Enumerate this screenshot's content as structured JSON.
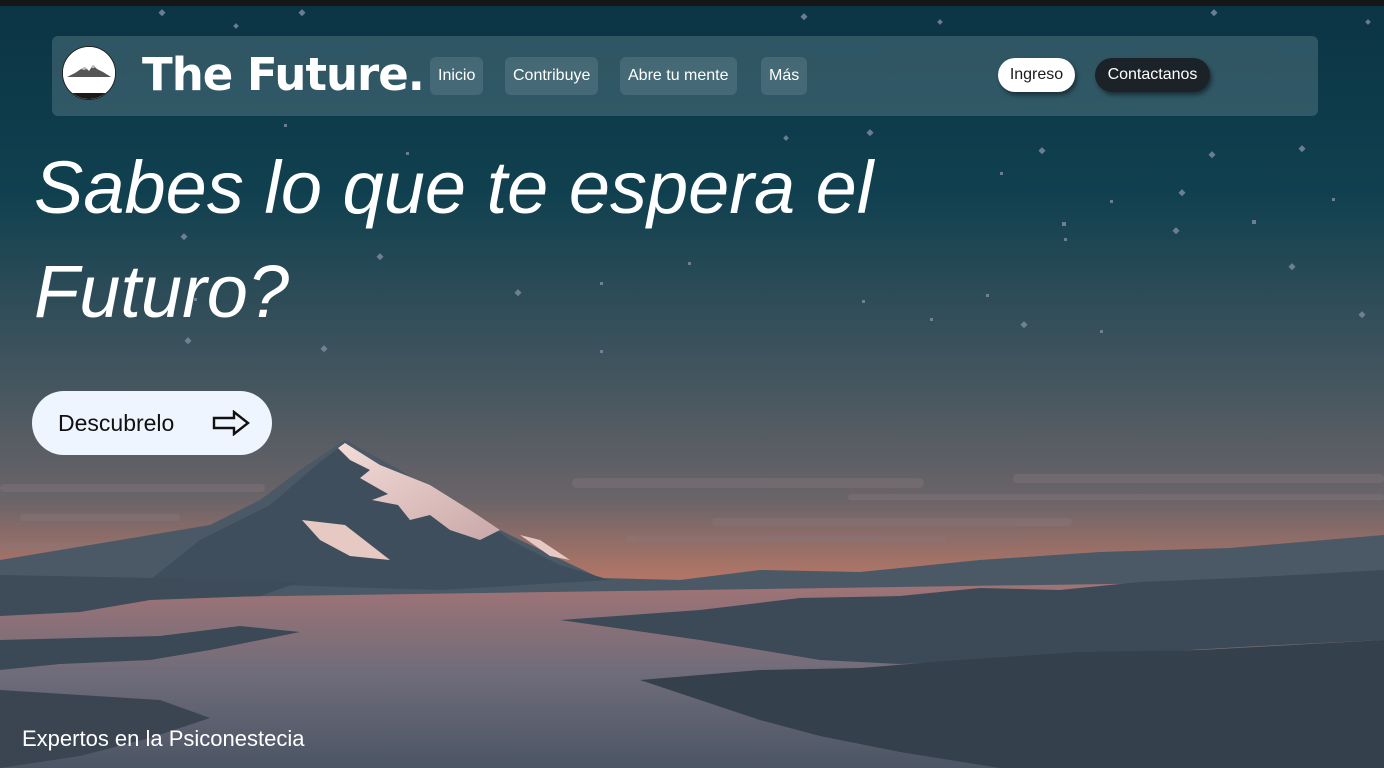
{
  "brand": {
    "name": "The Future.",
    "logo_icon": "mountain-logo-icon"
  },
  "nav": {
    "items": [
      {
        "label": "Inicio"
      },
      {
        "label": "Contribuye"
      },
      {
        "label": "Abre tu mente"
      },
      {
        "label": "Más"
      }
    ],
    "login_label": "Ingreso",
    "contact_label": "Contactanos"
  },
  "hero": {
    "headline": "Sabes lo que te espera el Futuro?",
    "cta_label": "Descubrelo",
    "cta_icon": "arrow-right-icon"
  },
  "footer": {
    "tagline": "Expertos en la Psiconestecia"
  },
  "colors": {
    "sky_top": "#0e3a4a",
    "sky_mid": "#475864",
    "horizon_glow": "#b7766a",
    "navbar_bg": "#5c7c88",
    "login_bg": "#ffffff",
    "contact_bg": "#1b2228",
    "cta_bg": "#eef5ff"
  }
}
